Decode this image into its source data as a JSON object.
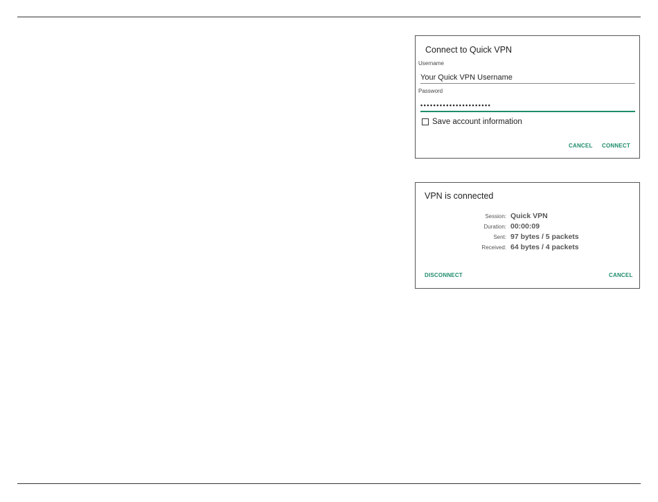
{
  "connect_dialog": {
    "title": "Connect to Quick VPN",
    "username_label": "Username",
    "username_value": "Your Quick VPN Username",
    "password_label": "Password",
    "password_value": "••••••••••••••••••••••",
    "save_account_label": "Save account information",
    "save_account_checked": false,
    "cancel_label": "CANCEL",
    "connect_label": "CONNECT"
  },
  "status_dialog": {
    "title": "VPN is connected",
    "rows": [
      {
        "key": "Session:",
        "value": "Quick VPN"
      },
      {
        "key": "Duration:",
        "value": "00:00:09"
      },
      {
        "key": "Sent:",
        "value": "97 bytes / 5 packets"
      },
      {
        "key": "Received:",
        "value": "64 bytes / 4 packets"
      }
    ],
    "disconnect_label": "DISCONNECT",
    "cancel_label": "CANCEL"
  },
  "colors": {
    "accent": "#1e8c6a",
    "text": "#1f1f1f",
    "muted": "#555555",
    "rule": "#333333"
  }
}
